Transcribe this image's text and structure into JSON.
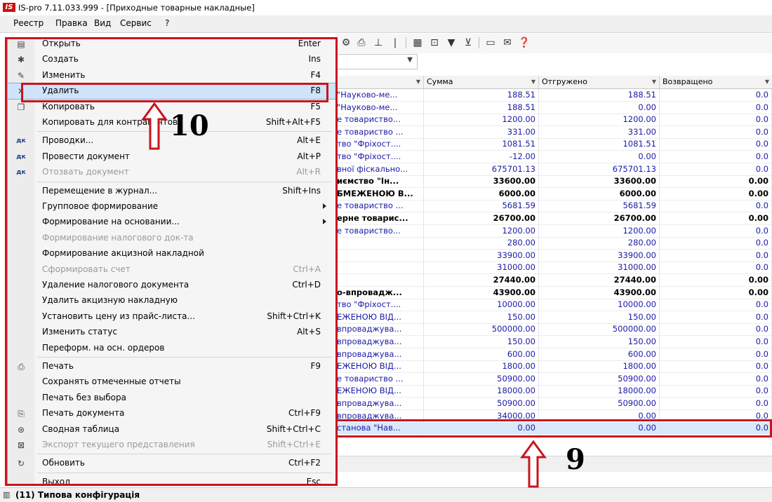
{
  "window": {
    "logo": "IS",
    "title": "IS-pro 7.11.033.999 - [Приходные товарные накладные]"
  },
  "menubar": [
    "Реестр",
    "Правка",
    "Вид",
    "Сервис",
    "?"
  ],
  "context_menu": {
    "items": [
      {
        "icon": "folder-open-icon",
        "label": "Открыть",
        "shortcut": "Enter"
      },
      {
        "icon": "new-doc-icon",
        "label": "Создать",
        "shortcut": "Ins"
      },
      {
        "icon": "edit-doc-icon",
        "label": "Изменить",
        "shortcut": "F4"
      },
      {
        "icon": "delete-doc-icon",
        "label": "Удалить",
        "shortcut": "F8",
        "highlighted": true
      },
      {
        "icon": "copy-icon",
        "label": "Копировать",
        "shortcut": "F5"
      },
      {
        "icon": "",
        "label": "Копировать для контрагентов",
        "shortcut": "Shift+Alt+F5"
      },
      {
        "icon": "ledger-entries-icon",
        "label": "Проводки...",
        "shortcut": "Alt+E"
      },
      {
        "icon": "post-document-icon",
        "label": "Провести документ",
        "shortcut": "Alt+P"
      },
      {
        "icon": "unpost-document-icon",
        "label": "Отозвать документ",
        "shortcut": "Alt+R",
        "disabled": true
      },
      {
        "icon": "",
        "label": "Перемещение в журнал...",
        "shortcut": "Shift+Ins"
      },
      {
        "icon": "",
        "label": "Групповое формирование",
        "shortcut": "",
        "submenu": true
      },
      {
        "icon": "",
        "label": "Формирование на основании...",
        "shortcut": "",
        "submenu": true
      },
      {
        "icon": "",
        "label": "Формирование налогового док-та",
        "shortcut": "",
        "disabled": true
      },
      {
        "icon": "",
        "label": "Формирование акцизной накладной",
        "shortcut": ""
      },
      {
        "icon": "",
        "label": "Сформировать счет",
        "shortcut": "Ctrl+A",
        "disabled": true
      },
      {
        "icon": "",
        "label": "Удаление налогового документа",
        "shortcut": "Ctrl+D"
      },
      {
        "icon": "",
        "label": "Удалить акцизную накладную",
        "shortcut": ""
      },
      {
        "icon": "",
        "label": "Установить цену из прайс-листа...",
        "shortcut": "Shift+Ctrl+K"
      },
      {
        "icon": "",
        "label": "Изменить статус",
        "shortcut": "Alt+S"
      },
      {
        "icon": "",
        "label": "Переформ. на осн. ордеров",
        "shortcut": ""
      },
      {
        "icon": "printer-icon",
        "label": "Печать",
        "shortcut": "F9"
      },
      {
        "icon": "",
        "label": "Сохранять отмеченные отчеты",
        "shortcut": ""
      },
      {
        "icon": "",
        "label": "Печать без выбора",
        "shortcut": ""
      },
      {
        "icon": "print-document-icon",
        "label": "Печать документа",
        "shortcut": "Ctrl+F9"
      },
      {
        "icon": "pivot-table-icon",
        "label": "Сводная таблица",
        "shortcut": "Shift+Ctrl+C"
      },
      {
        "icon": "excel-export-icon",
        "label": "Экспорт текущего представления",
        "shortcut": "Shift+Ctrl+E",
        "disabled": true
      },
      {
        "icon": "refresh-icon",
        "label": "Обновить",
        "shortcut": "Ctrl+F2"
      },
      {
        "icon": "",
        "label": "Выход",
        "shortcut": "Esc"
      }
    ]
  },
  "grid": {
    "columns": [
      {
        "label": ""
      },
      {
        "label": "Сумма"
      },
      {
        "label": "Отгружено"
      },
      {
        "label": "Возвращено"
      }
    ],
    "rows": [
      {
        "name": "\"Науково-ме...",
        "sum": "188.51",
        "shipped": "188.51",
        "returned": "0.0",
        "bold": false
      },
      {
        "name": "\"Науково-ме...",
        "sum": "188.51",
        "shipped": "0.00",
        "returned": "0.0",
        "bold": false
      },
      {
        "name": "е товариство...",
        "sum": "1200.00",
        "shipped": "1200.00",
        "returned": "0.0",
        "bold": false
      },
      {
        "name": "е товариство ...",
        "sum": "331.00",
        "shipped": "331.00",
        "returned": "0.0",
        "bold": false
      },
      {
        "name": "тво \"Фріхост....",
        "sum": "1081.51",
        "shipped": "1081.51",
        "returned": "0.0",
        "bold": false
      },
      {
        "name": "тво \"Фріхост....",
        "sum": "-12.00",
        "shipped": "0.00",
        "returned": "0.0",
        "bold": false
      },
      {
        "name": "вної фіскально...",
        "sum": "675701.13",
        "shipped": "675701.13",
        "returned": "0.0",
        "bold": false
      },
      {
        "name": "иємство \"Ін...",
        "sum": "33600.00",
        "shipped": "33600.00",
        "returned": "0.00",
        "bold": true
      },
      {
        "name": "БМЕЖЕНОЮ В...",
        "sum": "6000.00",
        "shipped": "6000.00",
        "returned": "0.00",
        "bold": true
      },
      {
        "name": "е товариство ...",
        "sum": "5681.59",
        "shipped": "5681.59",
        "returned": "0.0",
        "bold": false
      },
      {
        "name": "ерне товарис...",
        "sum": "26700.00",
        "shipped": "26700.00",
        "returned": "0.00",
        "bold": true
      },
      {
        "name": "е товариство...",
        "sum": "1200.00",
        "shipped": "1200.00",
        "returned": "0.0",
        "bold": false
      },
      {
        "name": "",
        "sum": "280.00",
        "shipped": "280.00",
        "returned": "0.0",
        "bold": false
      },
      {
        "name": "",
        "sum": "33900.00",
        "shipped": "33900.00",
        "returned": "0.0",
        "bold": false
      },
      {
        "name": "",
        "sum": "31000.00",
        "shipped": "31000.00",
        "returned": "0.0",
        "bold": false
      },
      {
        "name": "",
        "sum": "27440.00",
        "shipped": "27440.00",
        "returned": "0.00",
        "bold": true
      },
      {
        "name": "о-впровадж...",
        "sum": "43900.00",
        "shipped": "43900.00",
        "returned": "0.00",
        "bold": true
      },
      {
        "name": "тво \"Фріхост....",
        "sum": "10000.00",
        "shipped": "10000.00",
        "returned": "0.0",
        "bold": false
      },
      {
        "name": "ЕЖЕНОЮ ВІД...",
        "sum": "150.00",
        "shipped": "150.00",
        "returned": "0.0",
        "bold": false
      },
      {
        "name": "впроваджува...",
        "sum": "500000.00",
        "shipped": "500000.00",
        "returned": "0.0",
        "bold": false
      },
      {
        "name": "впроваджува...",
        "sum": "150.00",
        "shipped": "150.00",
        "returned": "0.0",
        "bold": false
      },
      {
        "name": "впроваджува...",
        "sum": "600.00",
        "shipped": "600.00",
        "returned": "0.0",
        "bold": false
      },
      {
        "name": "ЕЖЕНОЮ ВІД...",
        "sum": "1800.00",
        "shipped": "1800.00",
        "returned": "0.0",
        "bold": false
      },
      {
        "name": "е товариство ...",
        "sum": "50900.00",
        "shipped": "50900.00",
        "returned": "0.0",
        "bold": false
      },
      {
        "name": "ЕЖЕНОЮ ВІД...",
        "sum": "18000.00",
        "shipped": "18000.00",
        "returned": "0.0",
        "bold": false
      },
      {
        "name": "впроваджува...",
        "sum": "50900.00",
        "shipped": "50900.00",
        "returned": "0.0",
        "bold": false
      },
      {
        "name": "впроваджува...",
        "sum": "34000.00",
        "shipped": "0.00",
        "returned": "0.0",
        "bold": false
      },
      {
        "name": "станова \"Нав...",
        "sum": "0.00",
        "shipped": "0.00",
        "returned": "0.0",
        "bold": false,
        "selected": true
      }
    ]
  },
  "annotations": {
    "arrow_menu": "10",
    "arrow_row": "9"
  },
  "statusbar": {
    "text": "(11) Типова конфігурація"
  },
  "colors": {
    "accent": "#c8151c",
    "selection": "#cfe3fb",
    "link_text": "#1a1aa6"
  }
}
